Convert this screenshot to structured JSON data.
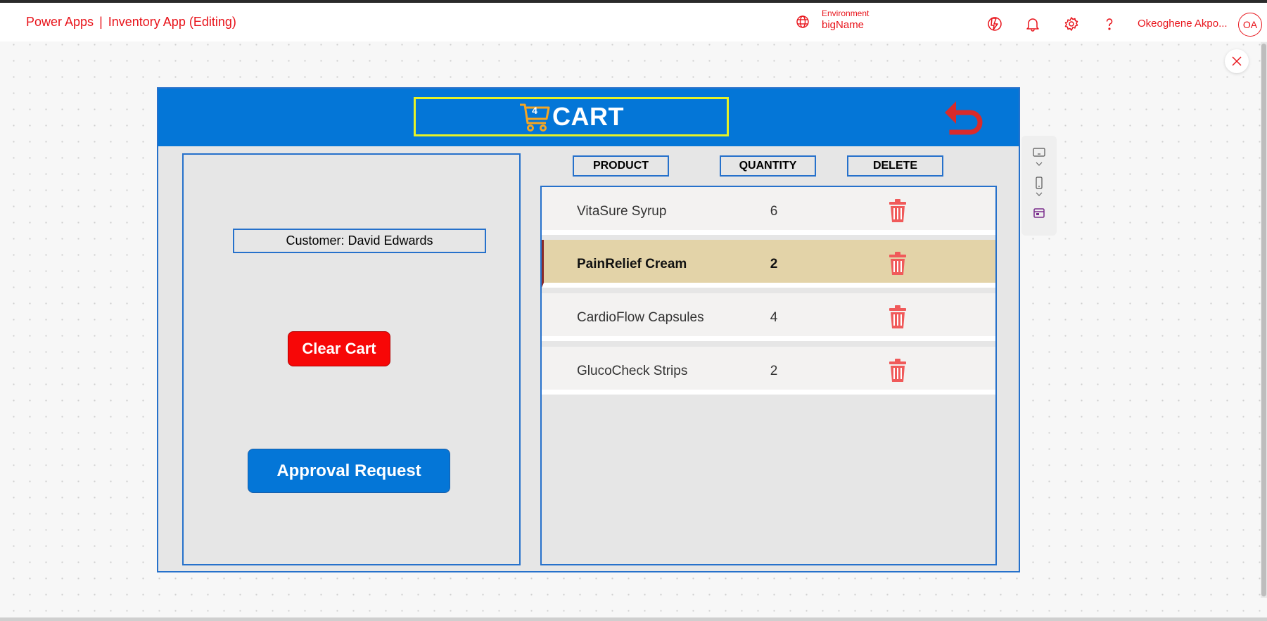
{
  "header": {
    "app_name": "Power Apps",
    "separator": "|",
    "app_title": "Inventory App (Editing)",
    "environment_label": "Environment",
    "environment_name": "bigName",
    "user_name": "Okeoghene Akpo...",
    "user_initials": "OA",
    "accent_color": "#e8141b"
  },
  "cart": {
    "title": "CART",
    "item_count": "4",
    "customer_label": "Customer: David Edwards",
    "clear_button": "Clear Cart",
    "approval_button": "Approval Request",
    "columns": [
      "PRODUCT",
      "QUANTITY",
      "DELETE"
    ],
    "items": [
      {
        "product": "VitaSure Syrup",
        "quantity": "6",
        "selected": false
      },
      {
        "product": "PainRelief Cream",
        "quantity": "2",
        "selected": true
      },
      {
        "product": "CardioFlow Capsules",
        "quantity": "4",
        "selected": false
      },
      {
        "product": "GlucoCheck Strips",
        "quantity": "2",
        "selected": false
      }
    ]
  },
  "colors": {
    "header_blue": "#0476d7",
    "clear_red": "#f70707",
    "selected_row": "#e3d3a8",
    "trash_red": "#f05a5a"
  }
}
